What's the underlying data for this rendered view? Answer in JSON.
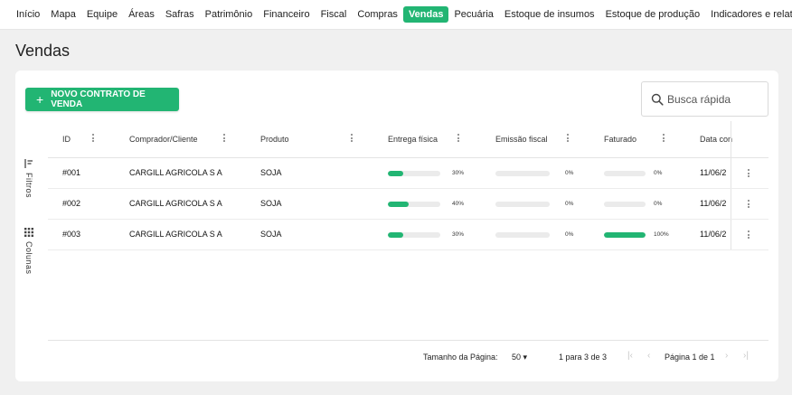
{
  "nav": {
    "items": [
      {
        "label": "Início",
        "active": false
      },
      {
        "label": "Mapa",
        "active": false
      },
      {
        "label": "Equipe",
        "active": false
      },
      {
        "label": "Áreas",
        "active": false
      },
      {
        "label": "Safras",
        "active": false
      },
      {
        "label": "Patrimônio",
        "active": false
      },
      {
        "label": "Financeiro",
        "active": false
      },
      {
        "label": "Fiscal",
        "active": false
      },
      {
        "label": "Compras",
        "active": false
      },
      {
        "label": "Vendas",
        "active": true
      },
      {
        "label": "Pecuária",
        "active": false
      },
      {
        "label": "Estoque de insumos",
        "active": false
      },
      {
        "label": "Estoque de produção",
        "active": false
      },
      {
        "label": "Indicadores e relatórios",
        "active": false
      }
    ]
  },
  "page": {
    "title": "Vendas"
  },
  "toolbar": {
    "new_button_label": "NOVO CONTRATO DE VENDA",
    "new_button_icon": "+"
  },
  "search": {
    "placeholder": "Busca rápida",
    "value": ""
  },
  "side_tools": {
    "filters_label": "Filtros",
    "columns_label": "Colunas"
  },
  "table": {
    "columns": [
      "ID",
      "Comprador/Cliente",
      "Produto",
      "Entrega física",
      "Emissão fiscal",
      "Faturado",
      "Data con"
    ],
    "rows": [
      {
        "id": "#001",
        "client": "CARGILL AGRICOLA S A",
        "product": "SOJA",
        "entrega_pct": 30,
        "entrega_label": "30%",
        "emissao_pct": 0,
        "emissao_label": "0%",
        "faturado_pct": 0,
        "faturado_label": "0%",
        "date": "11/06/2"
      },
      {
        "id": "#002",
        "client": "CARGILL AGRICOLA S A",
        "product": "SOJA",
        "entrega_pct": 40,
        "entrega_label": "40%",
        "emissao_pct": 0,
        "emissao_label": "0%",
        "faturado_pct": 0,
        "faturado_label": "0%",
        "date": "11/06/2"
      },
      {
        "id": "#003",
        "client": "CARGILL AGRICOLA S A",
        "product": "SOJA",
        "entrega_pct": 30,
        "entrega_label": "30%",
        "emissao_pct": 0,
        "emissao_label": "0%",
        "faturado_pct": 100,
        "faturado_label": "100%",
        "date": "11/06/2"
      }
    ]
  },
  "pagination": {
    "page_size_label": "Tamanho da Página:",
    "page_size": "50",
    "range": "1 para 3 de 3",
    "page_info": "Página 1 de 1"
  },
  "colors": {
    "accent": "#22b573",
    "track": "#ebebeb"
  }
}
